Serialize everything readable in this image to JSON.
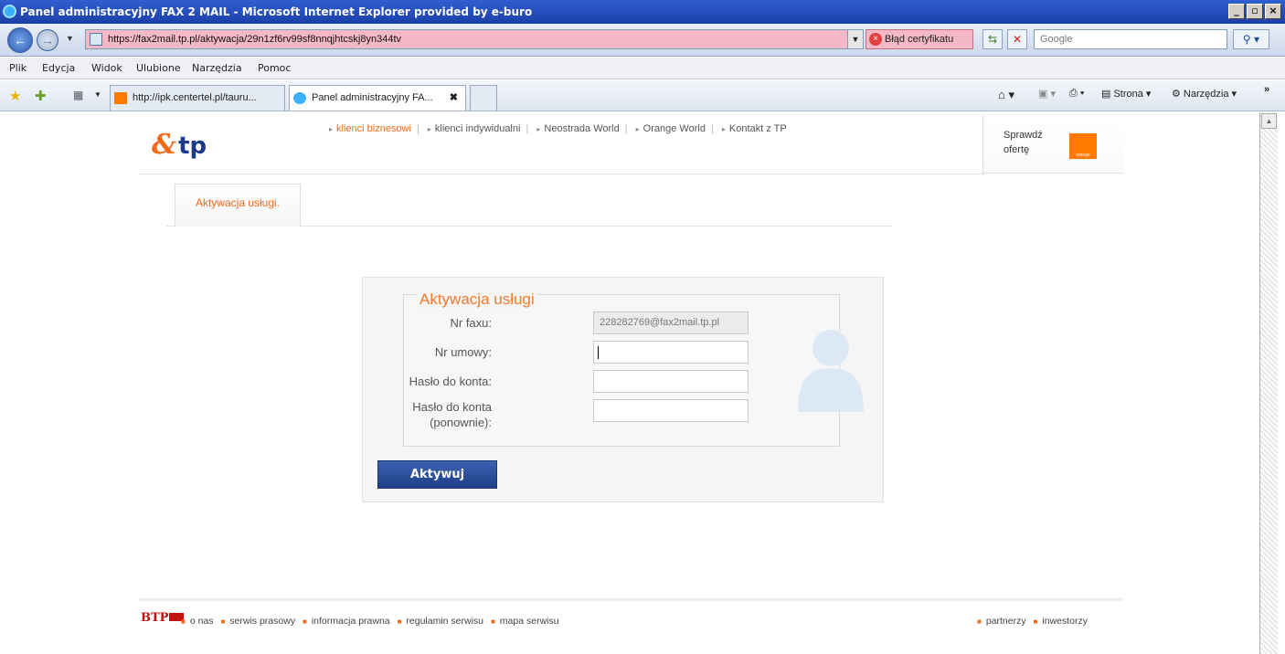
{
  "window": {
    "title": "Panel administracyjny FAX 2 MAIL - Microsoft Internet Explorer provided by e-buro"
  },
  "address": {
    "url": "https://fax2mail.tp.pl/aktywacja/29n1zf6rv99sf8nnqjhtcskj8yn344tv",
    "cert_error": "Błąd certyfikatu",
    "search_placeholder": "Google"
  },
  "menu": [
    "Plik",
    "Edycja",
    "Widok",
    "Ulubione",
    "Narzędzia",
    "Pomoc"
  ],
  "tabs": [
    {
      "label": "http://ipk.centertel.pl/tauru..."
    },
    {
      "label": "Panel administracyjny FA..."
    }
  ],
  "cmd": {
    "page": "Strona",
    "tools": "Narzędzia"
  },
  "site": {
    "logo_text": "tp",
    "nav": [
      "klienci biznesowi",
      "klienci indywidualni",
      "Neostrada World",
      "Orange World",
      "Kontakt z TP"
    ],
    "offer": {
      "line1": "Sprawdź",
      "line2": "ofertę",
      "brand": "orange"
    },
    "tab_label": "Aktywacja usługi.",
    "form": {
      "legend": "Aktywacja usługi",
      "fax_label": "Nr faxu:",
      "fax_value": "228282769@fax2mail.tp.pl",
      "contract_label": "Nr umowy:",
      "password_label": "Hasło do konta:",
      "password2_label": "Hasło do konta (ponownie):",
      "submit": "Aktywuj"
    },
    "footer": {
      "logo": "BTP",
      "links": [
        "o nas",
        "serwis prasowy",
        "informacja prawna",
        "regulamin serwisu",
        "mapa serwisu"
      ],
      "right_links": [
        "partnerzy",
        "inwestorzy"
      ]
    }
  }
}
